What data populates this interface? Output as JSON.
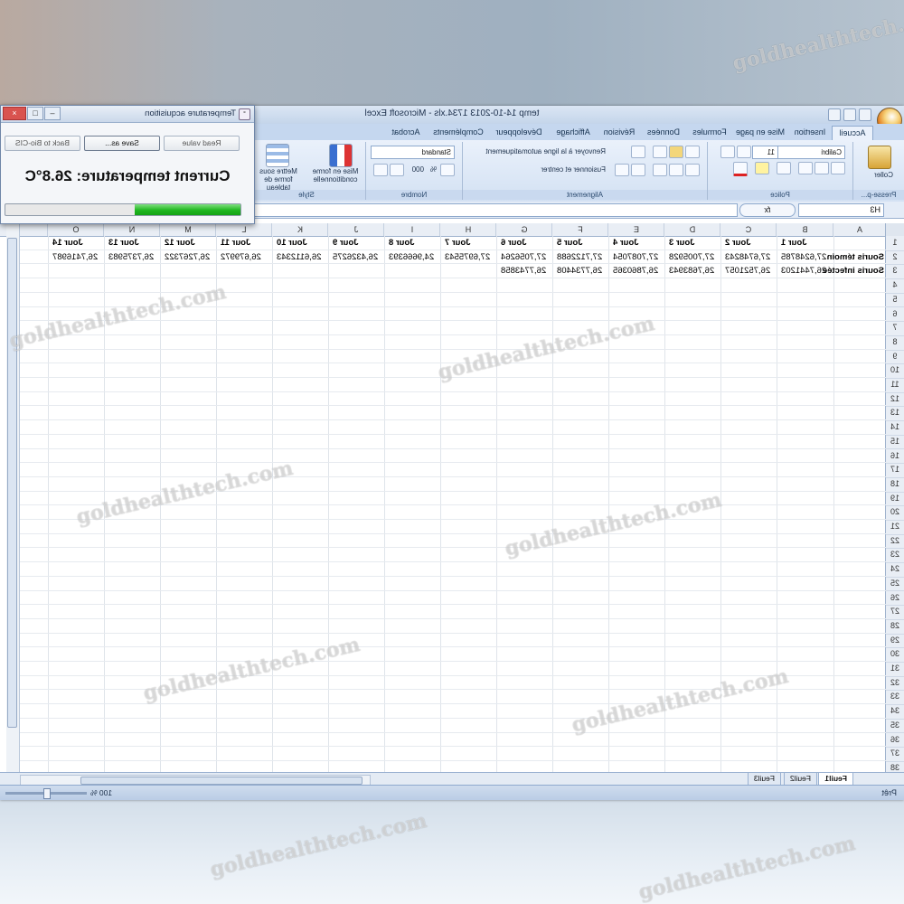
{
  "window": {
    "title": "temp 14-10-2013 1734.xls - Microsoft Excel",
    "tabs": [
      "Accueil",
      "Insertion",
      "Mise en page",
      "Formules",
      "Données",
      "Révision",
      "Affichage",
      "Développeur",
      "Compléments",
      "Acrobat"
    ],
    "active_tab": "Accueil"
  },
  "ribbon": {
    "clipboard": {
      "paste_label": "Coller",
      "group_label": "Presse-p..."
    },
    "font": {
      "name": "Calibri",
      "size": "11",
      "group_label": "Police"
    },
    "alignment": {
      "wrap_text": "Renvoyer à la ligne automatiquement",
      "merge_center": "Fusionner et centrer",
      "group_label": "Alignement"
    },
    "number": {
      "format": "Standard",
      "percent": "%",
      "thousands": "000",
      "group_label": "Nombre"
    },
    "style": {
      "conditional_format": "Mise en forme conditionnelle",
      "table_format": "Mettre sous forme de tableau",
      "group_label": "Style"
    }
  },
  "formula_bar": {
    "name_box": "H3",
    "fx": "fx",
    "value": ""
  },
  "sheet": {
    "columns": [
      "A",
      "B",
      "C",
      "D",
      "E",
      "F",
      "G",
      "H",
      "I",
      "J",
      "K",
      "L",
      "M",
      "N",
      "O"
    ],
    "row_numbers": [
      "1",
      "2",
      "3",
      "4",
      "5",
      "6",
      "7",
      "8",
      "9",
      "10",
      "11",
      "12",
      "13",
      "14",
      "15",
      "16",
      "17",
      "18",
      "19",
      "20",
      "21",
      "22",
      "23",
      "24",
      "25",
      "26",
      "27",
      "28",
      "29",
      "30",
      "31",
      "32",
      "33",
      "34",
      "35",
      "36",
      "37",
      "38"
    ],
    "headers": [
      "Jour 1",
      "Jour 2",
      "Jour 3",
      "Jour 4",
      "Jour 5",
      "Jour 6",
      "Jour 7",
      "Jour 8",
      "Jour 9",
      "Jour 10",
      "Jour 11",
      "Jour 12",
      "Jour 13",
      "Jour 14"
    ],
    "rows": [
      {
        "label": "Souris témoin",
        "values": [
          "27,6248785",
          "27,6748243",
          "27,7005928",
          "27,7087054",
          "27,7122688",
          "27,7056264",
          "27,6975543",
          "24,9666393",
          "26,4326275",
          "26,6112343",
          "26,679972",
          "26,7267322",
          "26,7375983",
          "26,7416987"
        ]
      },
      {
        "label": "Souris infectée",
        "values": [
          "26,7441203",
          "26,7521057",
          "26,7683943",
          "26,7860365",
          "26,7734408",
          "26,7743858",
          "",
          "",
          "",
          "",
          "",
          "",
          "",
          ""
        ]
      }
    ]
  },
  "sheet_tabs": [
    "Feuil1",
    "Feuil2",
    "Feuil3"
  ],
  "active_sheet": "Feuil1",
  "status": {
    "text": "Prêt",
    "zoom": "100 %"
  },
  "dialog": {
    "title": "Temperature acquisition",
    "buttons": {
      "read_value": "Read value",
      "save_as": "Save as...",
      "back": "Back to Bio-CIS"
    },
    "temperature_text": "Current temperature: 26.8°C",
    "progress": 0.45,
    "progress_color": "#22b422"
  },
  "watermark": "goldhealthtech.com",
  "colors": {
    "ribbon": "#dbe6f4",
    "accent": "#2b579a",
    "grid": "#dfe4ea"
  }
}
